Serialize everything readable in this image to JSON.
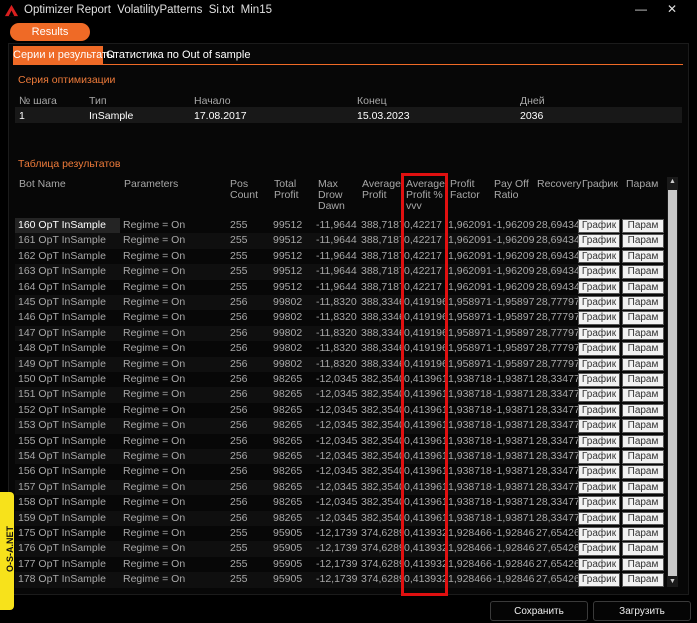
{
  "window": {
    "title": "Optimizer Report  VolatilityPatterns  Si.txt  Min15",
    "minimize_icon": "minimize-icon",
    "close_icon": "close-icon"
  },
  "toolbar": {
    "results_label": "Results"
  },
  "tabs": [
    {
      "label": "Серии и результаты",
      "active": true
    },
    {
      "label": "Статистика по Out of sample",
      "active": false
    }
  ],
  "series_section": {
    "title": "Серия оптимизации",
    "headers": [
      "№ шага",
      "Тип",
      "Начало",
      "Конец",
      "Дней"
    ],
    "row": [
      "1",
      "InSample",
      "17.08.2017",
      "15.03.2023",
      "2036"
    ]
  },
  "results_section": {
    "title": "Таблица результатов",
    "headers": {
      "bot_name": "Bot Name",
      "parameters": "Parameters",
      "pos_count": [
        "Pos",
        "Count"
      ],
      "total_profit": [
        "Total",
        "Profit"
      ],
      "max_drawdown": [
        "Max",
        "Drow",
        "Dawn"
      ],
      "average_profit": [
        "Average",
        "Profit"
      ],
      "average_profit_pct": [
        "Average",
        "Profit %",
        "vvv"
      ],
      "profit_factor": [
        "Profit",
        "Factor"
      ],
      "payoff_ratio": [
        "Pay Off",
        "Ratio"
      ],
      "recovery": "Recovery",
      "chart": "График",
      "param": "Парам"
    },
    "row_button_chart": "График",
    "row_button_param": "Парам",
    "rows": [
      [
        "160 OpT InSample",
        "Regime = On",
        "255",
        "99512",
        "-11,9644",
        "388,7187",
        "0,42217",
        "1,962091",
        "-1,96209",
        "28,69434"
      ],
      [
        "161 OpT InSample",
        "Regime = On",
        "255",
        "99512",
        "-11,9644",
        "388,7187",
        "0,42217",
        "1,962091",
        "-1,96209",
        "28,69434"
      ],
      [
        "162 OpT InSample",
        "Regime = On",
        "255",
        "99512",
        "-11,9644",
        "388,7187",
        "0,42217",
        "1,962091",
        "-1,96209",
        "28,69434"
      ],
      [
        "163 OpT InSample",
        "Regime = On",
        "255",
        "99512",
        "-11,9644",
        "388,7187",
        "0,42217",
        "1,962091",
        "-1,96209",
        "28,69434"
      ],
      [
        "164 OpT InSample",
        "Regime = On",
        "255",
        "99512",
        "-11,9644",
        "388,7187",
        "0,42217",
        "1,962091",
        "-1,96209",
        "28,69434"
      ],
      [
        "145 OpT InSample",
        "Regime = On",
        "256",
        "99802",
        "-11,8320",
        "388,3346",
        "0,419196",
        "1,958971",
        "-1,95897",
        "28,77797"
      ],
      [
        "146 OpT InSample",
        "Regime = On",
        "256",
        "99802",
        "-11,8320",
        "388,3346",
        "0,419196",
        "1,958971",
        "-1,95897",
        "28,77797"
      ],
      [
        "147 OpT InSample",
        "Regime = On",
        "256",
        "99802",
        "-11,8320",
        "388,3346",
        "0,419196",
        "1,958971",
        "-1,95897",
        "28,77797"
      ],
      [
        "148 OpT InSample",
        "Regime = On",
        "256",
        "99802",
        "-11,8320",
        "388,3346",
        "0,419196",
        "1,958971",
        "-1,95897",
        "28,77797"
      ],
      [
        "149 OpT InSample",
        "Regime = On",
        "256",
        "99802",
        "-11,8320",
        "388,3346",
        "0,419196",
        "1,958971",
        "-1,95897",
        "28,77797"
      ],
      [
        "150 OpT InSample",
        "Regime = On",
        "256",
        "98265",
        "-12,0345",
        "382,3540",
        "0,413961",
        "1,938718",
        "-1,93871",
        "28,33477"
      ],
      [
        "151 OpT InSample",
        "Regime = On",
        "256",
        "98265",
        "-12,0345",
        "382,3540",
        "0,413961",
        "1,938718",
        "-1,93871",
        "28,33477"
      ],
      [
        "152 OpT InSample",
        "Regime = On",
        "256",
        "98265",
        "-12,0345",
        "382,3540",
        "0,413961",
        "1,938718",
        "-1,93871",
        "28,33477"
      ],
      [
        "153 OpT InSample",
        "Regime = On",
        "256",
        "98265",
        "-12,0345",
        "382,3540",
        "0,413961",
        "1,938718",
        "-1,93871",
        "28,33477"
      ],
      [
        "155 OpT InSample",
        "Regime = On",
        "256",
        "98265",
        "-12,0345",
        "382,3540",
        "0,413961",
        "1,938718",
        "-1,93871",
        "28,33477"
      ],
      [
        "154 OpT InSample",
        "Regime = On",
        "256",
        "98265",
        "-12,0345",
        "382,3540",
        "0,413961",
        "1,938718",
        "-1,93871",
        "28,33477"
      ],
      [
        "156 OpT InSample",
        "Regime = On",
        "256",
        "98265",
        "-12,0345",
        "382,3540",
        "0,413961",
        "1,938718",
        "-1,93871",
        "28,33477"
      ],
      [
        "157 OpT InSample",
        "Regime = On",
        "256",
        "98265",
        "-12,0345",
        "382,3540",
        "0,413961",
        "1,938718",
        "-1,93871",
        "28,33477"
      ],
      [
        "158 OpT InSample",
        "Regime = On",
        "256",
        "98265",
        "-12,0345",
        "382,3540",
        "0,413961",
        "1,938718",
        "-1,93871",
        "28,33477"
      ],
      [
        "159 OpT InSample",
        "Regime = On",
        "256",
        "98265",
        "-12,0345",
        "382,3540",
        "0,413961",
        "1,938718",
        "-1,93871",
        "28,33477"
      ],
      [
        "175 OpT InSample",
        "Regime = On",
        "255",
        "95905",
        "-12,1739",
        "374,6289",
        "0,413932",
        "1,928466",
        "-1,92846",
        "27,65426"
      ],
      [
        "176 OpT InSample",
        "Regime = On",
        "255",
        "95905",
        "-12,1739",
        "374,6289",
        "0,413932",
        "1,928466",
        "-1,92846",
        "27,65426"
      ],
      [
        "177 OpT InSample",
        "Regime = On",
        "255",
        "95905",
        "-12,1739",
        "374,6289",
        "0,413932",
        "1,928466",
        "-1,92846",
        "27,65426"
      ],
      [
        "178 OpT InSample",
        "Regime = On",
        "255",
        "95905",
        "-12,1739",
        "374,6289",
        "0,413932",
        "1,928466",
        "-1,92846",
        "27,65426"
      ]
    ]
  },
  "footer": {
    "save_label": "Сохранить",
    "load_label": "Загрузить"
  },
  "watermark": {
    "text": "O-S-A.NET"
  },
  "colors": {
    "accent": "#ef6a26",
    "highlight_box": "#e01010",
    "background": "#000000",
    "watermark_bg": "#f7e21b"
  }
}
